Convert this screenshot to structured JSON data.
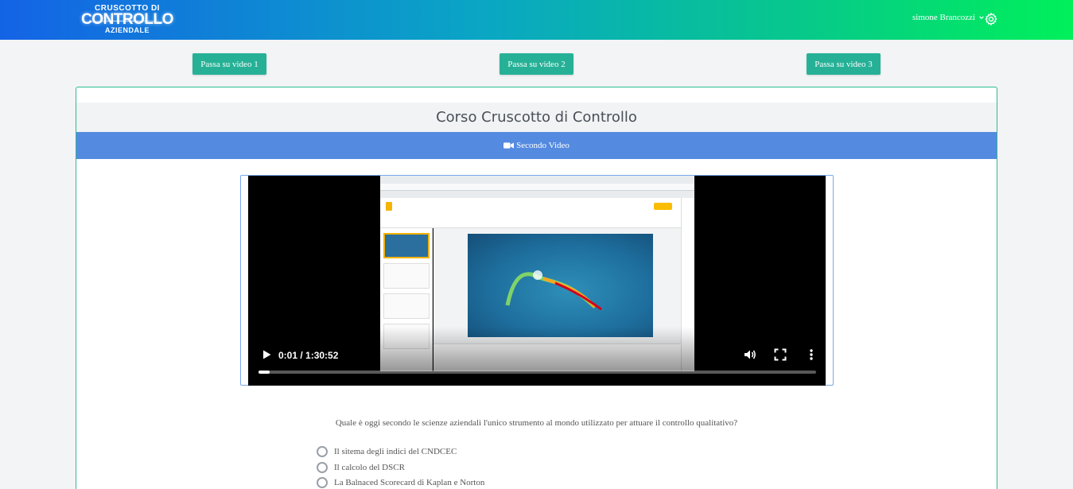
{
  "header": {
    "logo": {
      "line1": "CRUSCOTTO DI",
      "line2": "CONTROLLO",
      "line3": "AZIENDALE"
    },
    "user_name": "simone Brancozzi",
    "icons": {
      "dropdown": "chevron-down-icon",
      "settings": "gear-icon"
    }
  },
  "video_buttons": [
    {
      "label": "Passa su video 1"
    },
    {
      "label": "Passa su video 2"
    },
    {
      "label": "Passa su video 3"
    }
  ],
  "course": {
    "title": "Corso Cruscotto di Controllo",
    "section_title": "Secondo Video",
    "section_icon": "video-camera-icon"
  },
  "player": {
    "current_time": "0:01",
    "duration": "1:30:52",
    "time_display": "0:01 / 1:30:52",
    "progress_fraction": 0.02,
    "icons": {
      "play": "play-icon",
      "volume": "volume-icon",
      "fullscreen": "fullscreen-icon",
      "menu": "more-vertical-icon"
    }
  },
  "quiz": {
    "question": "Quale è oggi secondo le scienze aziendali l'unico strumento al mondo utilizzato per attuare il controllo qualitativo?",
    "options": [
      {
        "label": "Il sitema degli indici del CNDCEC"
      },
      {
        "label": "Il calcolo del DSCR"
      },
      {
        "label": "La Balnaced Scorecard di Kaplan e Norton"
      }
    ]
  },
  "colors": {
    "accent_button": "#26b197",
    "section_bar": "#548ae0",
    "card_border": "#2dbb8e",
    "header_gradient_start": "#1463e6",
    "header_gradient_end": "#00f05a"
  }
}
